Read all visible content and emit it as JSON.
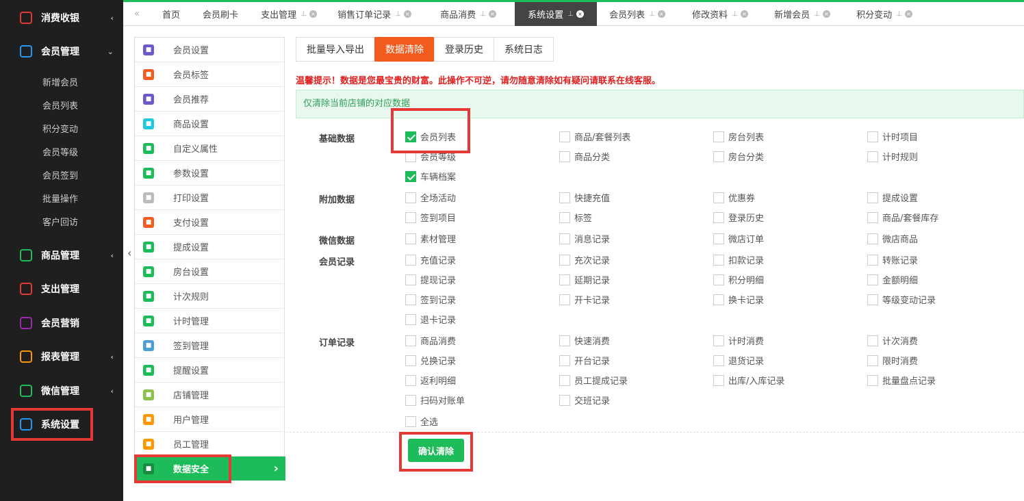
{
  "sidebar": {
    "main": [
      {
        "label": "消费收银",
        "icon": "cashier-icon",
        "color": "#e53935",
        "arrow": "‹"
      },
      {
        "label": "会员管理",
        "icon": "members-icon",
        "color": "#2196f3",
        "arrow": "⌄"
      },
      {
        "label": "商品管理",
        "icon": "goods-icon",
        "color": "#1dbb59",
        "arrow": "‹"
      },
      {
        "label": "支出管理",
        "icon": "expense-icon",
        "color": "#e53935",
        "arrow": ""
      },
      {
        "label": "会员营销",
        "icon": "gift-icon",
        "color": "#9c27b0",
        "arrow": ""
      },
      {
        "label": "报表管理",
        "icon": "report-icon",
        "color": "#ff9800",
        "arrow": "‹"
      },
      {
        "label": "微信管理",
        "icon": "wechat-icon",
        "color": "#1dbb59",
        "arrow": "‹"
      },
      {
        "label": "系统设置",
        "icon": "settings-icon",
        "color": "#2196f3",
        "arrow": ""
      }
    ],
    "sub": [
      "新增会员",
      "会员列表",
      "积分变动",
      "会员等级",
      "会员签到",
      "批量操作",
      "客户回访"
    ]
  },
  "tabs": [
    {
      "label": "首页",
      "pin": false
    },
    {
      "label": "会员刷卡",
      "pin": false
    },
    {
      "label": "支出管理",
      "pin": true
    },
    {
      "label": "销售订单记录",
      "pin": true
    },
    {
      "label": "商品消费",
      "pin": true
    },
    {
      "label": "系统设置",
      "pin": true
    },
    {
      "label": "会员列表",
      "pin": true
    },
    {
      "label": "修改资料",
      "pin": true
    },
    {
      "label": "新增会员",
      "pin": true
    },
    {
      "label": "积分变动",
      "pin": true
    }
  ],
  "tab_back": "«",
  "left_menu": [
    {
      "label": "会员设置",
      "color": "#6a5acd"
    },
    {
      "label": "会员标签",
      "color": "#f25c1f"
    },
    {
      "label": "会员推荐",
      "color": "#6a5acd"
    },
    {
      "label": "商品设置",
      "color": "#1ec8e0"
    },
    {
      "label": "自定义属性",
      "color": "#1dbb59"
    },
    {
      "label": "参数设置",
      "color": "#1dbb59"
    },
    {
      "label": "打印设置",
      "color": "#bbbbbb"
    },
    {
      "label": "支付设置",
      "color": "#f25c1f"
    },
    {
      "label": "提成设置",
      "color": "#1dbb59"
    },
    {
      "label": "房台设置",
      "color": "#1dbb59"
    },
    {
      "label": "计次规则",
      "color": "#1dbb59"
    },
    {
      "label": "计时管理",
      "color": "#1dbb59"
    },
    {
      "label": "签到管理",
      "color": "#4a9fd5"
    },
    {
      "label": "提醒设置",
      "color": "#1dbb59"
    },
    {
      "label": "店铺管理",
      "color": "#8bc34a"
    },
    {
      "label": "用户管理",
      "color": "#ff9800"
    },
    {
      "label": "员工管理",
      "color": "#ff9800"
    },
    {
      "label": "数据安全",
      "color": "#1a8a40"
    }
  ],
  "active_arrow": "›",
  "collapse": "‹",
  "subtabs": [
    "批量导入导出",
    "数据清除",
    "登录历史",
    "系统日志"
  ],
  "warning": "温馨提示！数据是您最宝贵的财富。此操作不可逆，请勿随意清除如有疑问请联系在线客服。",
  "info": "仅清除当前店铺的对应数据",
  "groups": [
    "基础数据",
    "附加数据",
    "微信数据",
    "会员记录",
    "订单记录"
  ],
  "checks": [
    [
      "会员列表",
      true
    ],
    [
      "商品/套餐列表",
      false
    ],
    [
      "房台列表",
      false
    ],
    [
      "计时项目",
      false
    ],
    [
      "会员等级",
      false
    ],
    [
      "商品分类",
      false
    ],
    [
      "房台分类",
      false
    ],
    [
      "计时规则",
      false
    ],
    [
      "车辆档案",
      true
    ],
    [
      "全场活动",
      false
    ],
    [
      "快捷充值",
      false
    ],
    [
      "优惠券",
      false
    ],
    [
      "提成设置",
      false
    ],
    [
      "签到项目",
      false
    ],
    [
      "标签",
      false
    ],
    [
      "登录历史",
      false
    ],
    [
      "商品/套餐库存",
      false
    ],
    [
      "素材管理",
      false
    ],
    [
      "消息记录",
      false
    ],
    [
      "微店订单",
      false
    ],
    [
      "微店商品",
      false
    ],
    [
      "充值记录",
      false
    ],
    [
      "充次记录",
      false
    ],
    [
      "扣款记录",
      false
    ],
    [
      "转账记录",
      false
    ],
    [
      "提现记录",
      false
    ],
    [
      "延期记录",
      false
    ],
    [
      "积分明细",
      false
    ],
    [
      "金额明细",
      false
    ],
    [
      "签到记录",
      false
    ],
    [
      "开卡记录",
      false
    ],
    [
      "换卡记录",
      false
    ],
    [
      "等级变动记录",
      false
    ],
    [
      "退卡记录",
      false
    ],
    [
      "商品消费",
      false
    ],
    [
      "快速消费",
      false
    ],
    [
      "计时消费",
      false
    ],
    [
      "计次消费",
      false
    ],
    [
      "兑换记录",
      false
    ],
    [
      "开台记录",
      false
    ],
    [
      "退货记录",
      false
    ],
    [
      "限时消费",
      false
    ],
    [
      "返利明细",
      false
    ],
    [
      "员工提成记录",
      false
    ],
    [
      "出库/入库记录",
      false
    ],
    [
      "批量盘点记录",
      false
    ],
    [
      "扫码对账单",
      false
    ],
    [
      "交班记录",
      false
    ],
    [
      "全选",
      false
    ]
  ],
  "confirm_label": "确认清除",
  "accent": "#1dbb59",
  "active_tab_color": "#f25c1f"
}
